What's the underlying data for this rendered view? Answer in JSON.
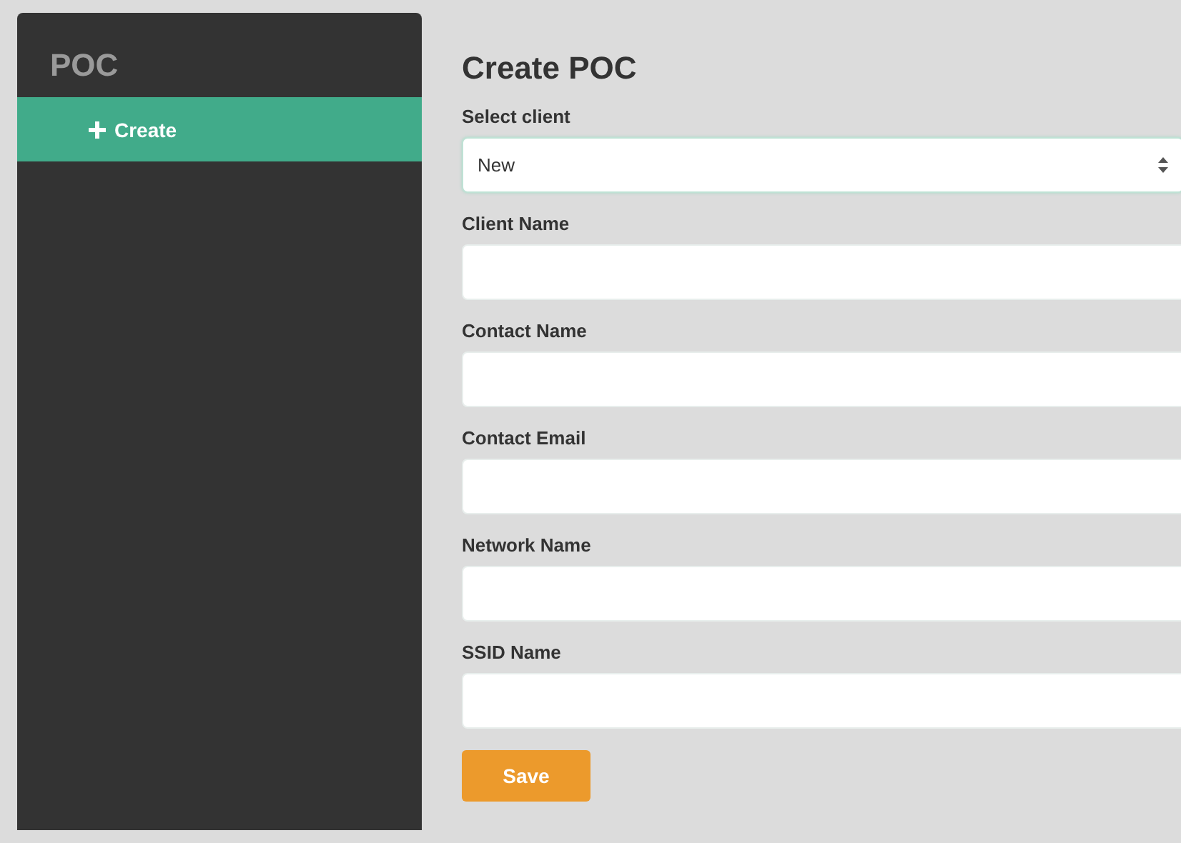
{
  "sidebar": {
    "title": "POC",
    "items": [
      {
        "label": "Create",
        "selected": true
      }
    ]
  },
  "form": {
    "title": "Create POC",
    "fields": [
      {
        "kind": "select",
        "label": "Select client",
        "value": "New"
      },
      {
        "kind": "text",
        "label": "Client Name"
      },
      {
        "kind": "text",
        "label": "Contact Name"
      },
      {
        "kind": "text",
        "label": "Contact Email"
      },
      {
        "kind": "text",
        "label": "Network Name"
      },
      {
        "kind": "text",
        "label": "SSID Name"
      }
    ],
    "submit": "Save"
  }
}
